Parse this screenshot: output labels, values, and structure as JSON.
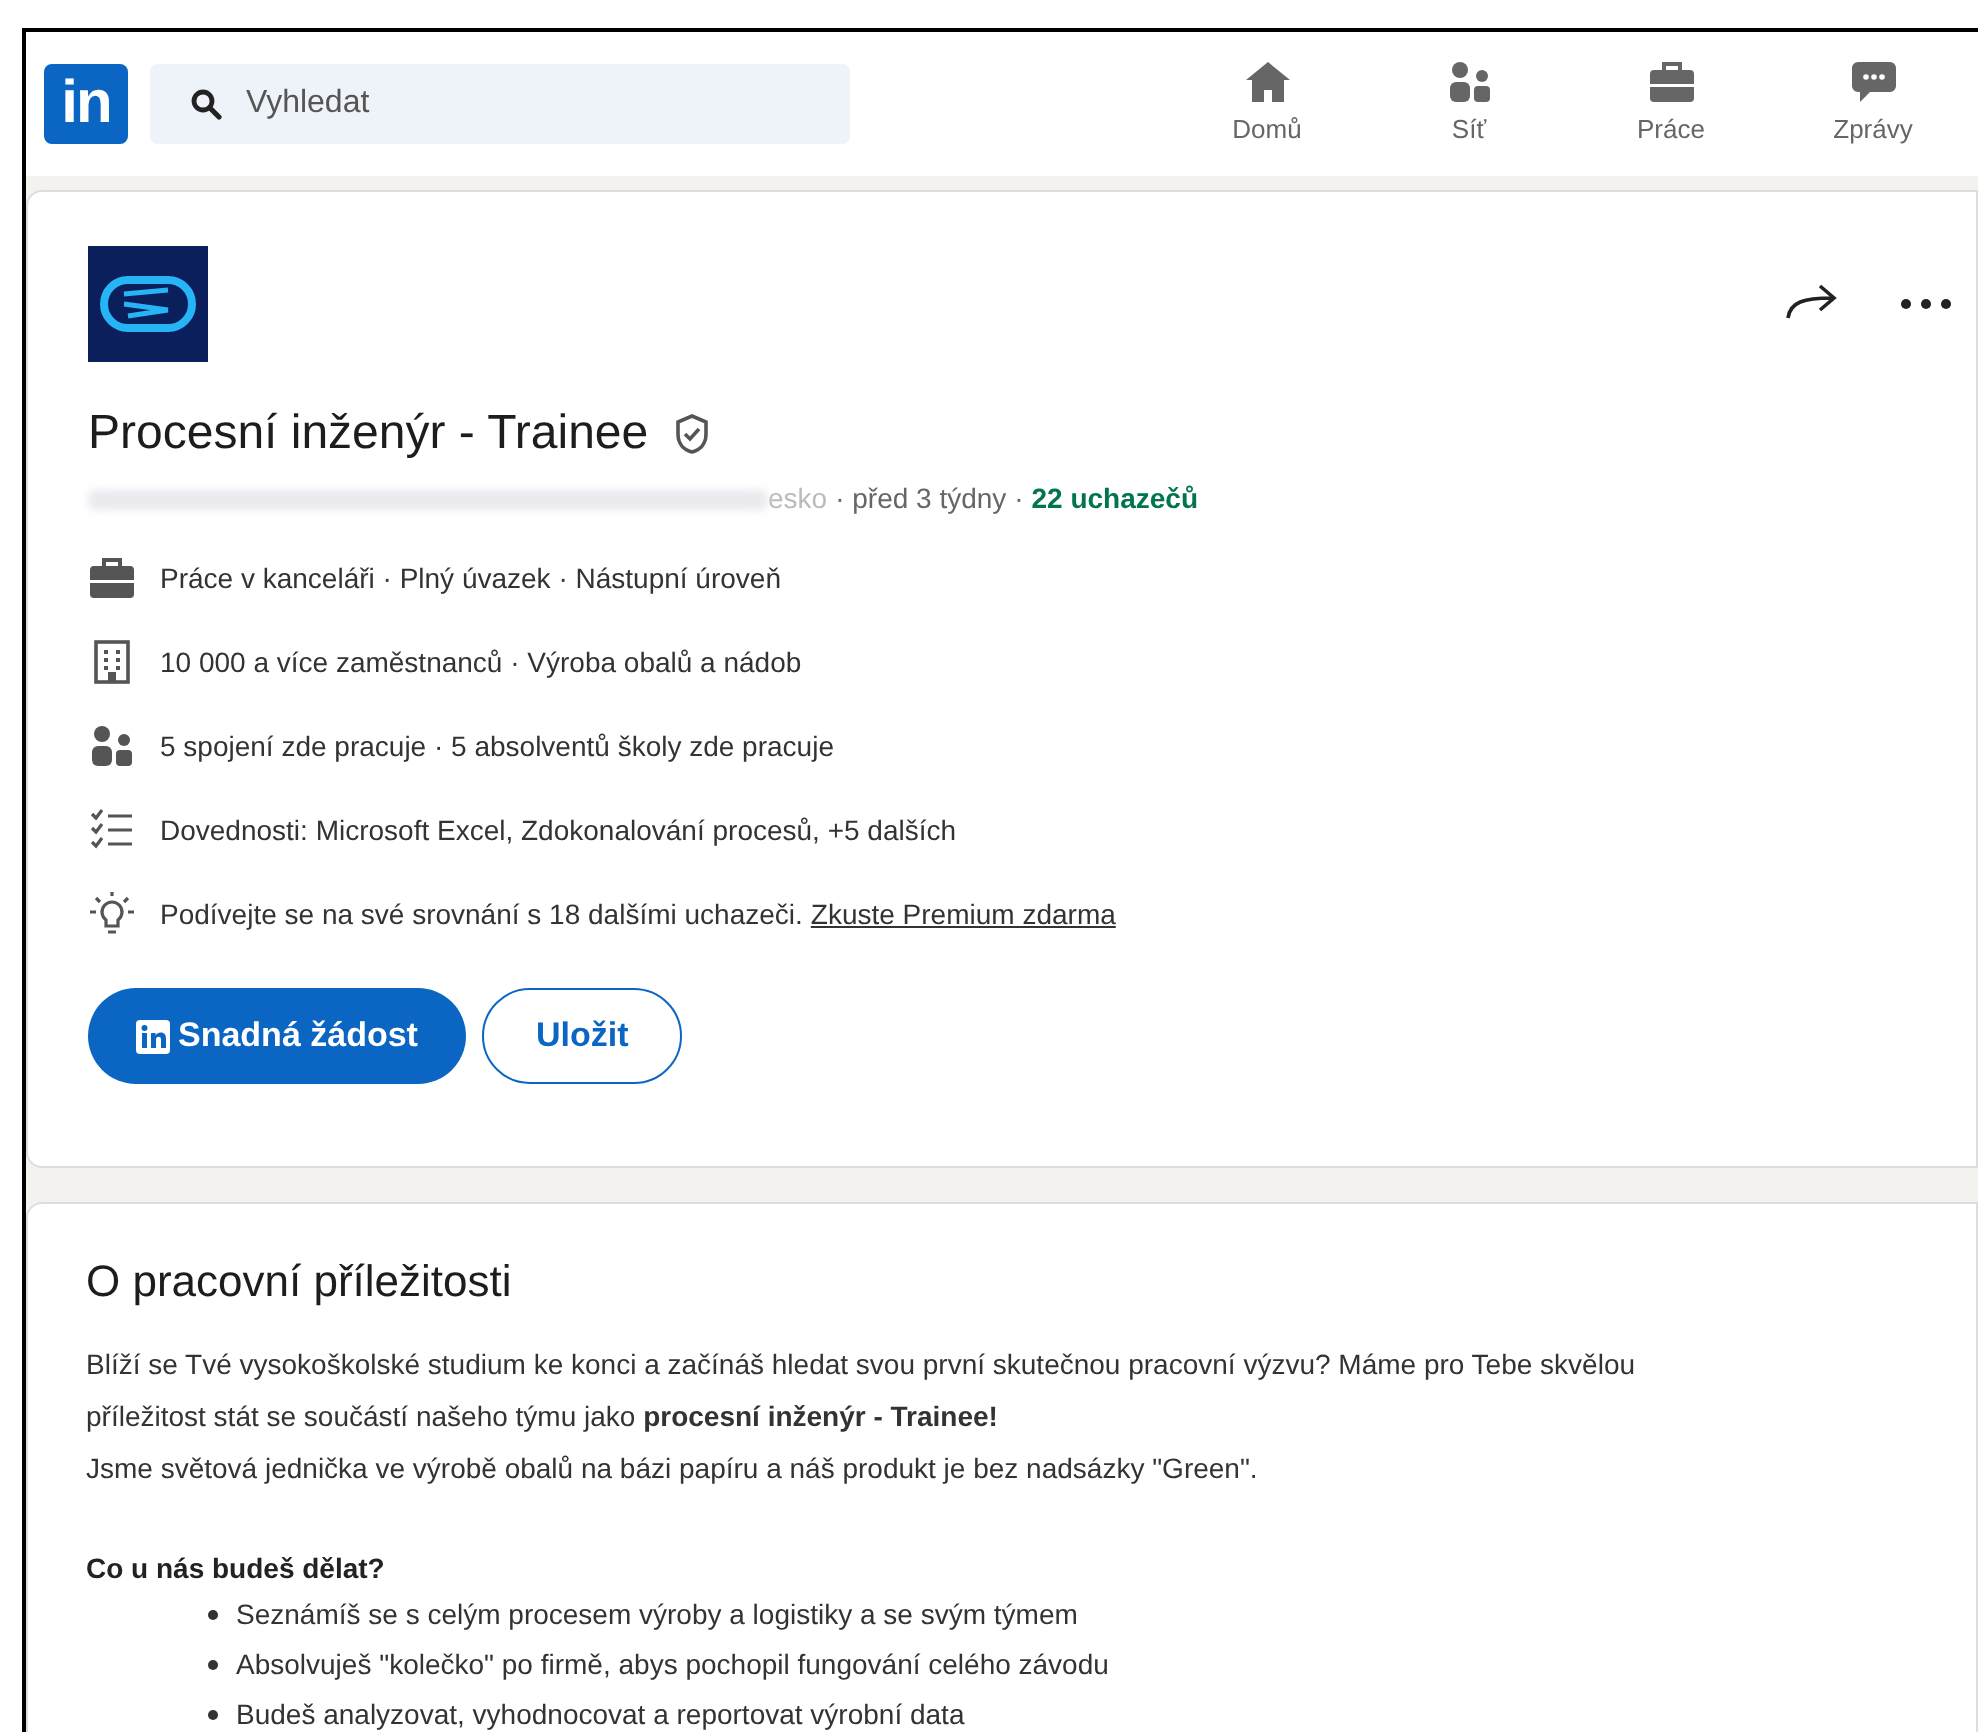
{
  "nav": {
    "logo": "in",
    "search": {
      "placeholder": "Vyhledat"
    },
    "items": [
      {
        "kind": "home",
        "label": "Domů"
      },
      {
        "kind": "network",
        "label": "Síť"
      },
      {
        "kind": "jobs",
        "label": "Práce"
      },
      {
        "kind": "messages",
        "label": "Zprávy"
      }
    ]
  },
  "job": {
    "title": "Procesní inženýr - Trainee",
    "location": "esko",
    "posted": "· před 3 týdny ·",
    "applicants": "22 uchazečů",
    "facts": [
      {
        "kind": "briefcase",
        "text": "Práce v kanceláři · Plný úvazek · Nástupní úroveň"
      },
      {
        "kind": "building",
        "text": "10 000 a více zaměstnanců · Výroba obalů a nádob"
      },
      {
        "kind": "people",
        "text": "5 spojení zde pracuje · 5 absolventů školy zde pracuje"
      },
      {
        "kind": "checklist",
        "text": "Dovednosti: Microsoft Excel, Zdokonalování procesů, +5 dalších"
      },
      {
        "kind": "bulb",
        "text": "Podívejte se na své srovnání s 18 dalšími uchazeči.",
        "link": "Zkuste Premium zdarma"
      }
    ],
    "apply": "Snadná žádost",
    "save": "Uložit"
  },
  "about": {
    "heading": "O pracovní příležitosti",
    "paragraph": [
      "Blíží se Tvé vysokoškolské studium ke konci a začínáš hledat svou první skutečnou pracovní výzvu? Máme pro Tebe skvělou",
      "příležitost stát se součástí našeho týmu jako **procesní inženýr - Trainee!**",
      "Jsme světová jednička ve výrobě obalů na bázi papíru a náš produkt je bez nadsázky \"Green\"."
    ],
    "subheading": "Co u nás budeš dělat?",
    "bullets": [
      "Seznámíš se s celým procesem výroby a logistiky a se svým týmem",
      "Absolvuješ \"kolečko\" po firmě, abys pochopil fungování celého závodu",
      "Budeš analyzovat, vyhodnocovat a reportovat výrobní data"
    ]
  }
}
